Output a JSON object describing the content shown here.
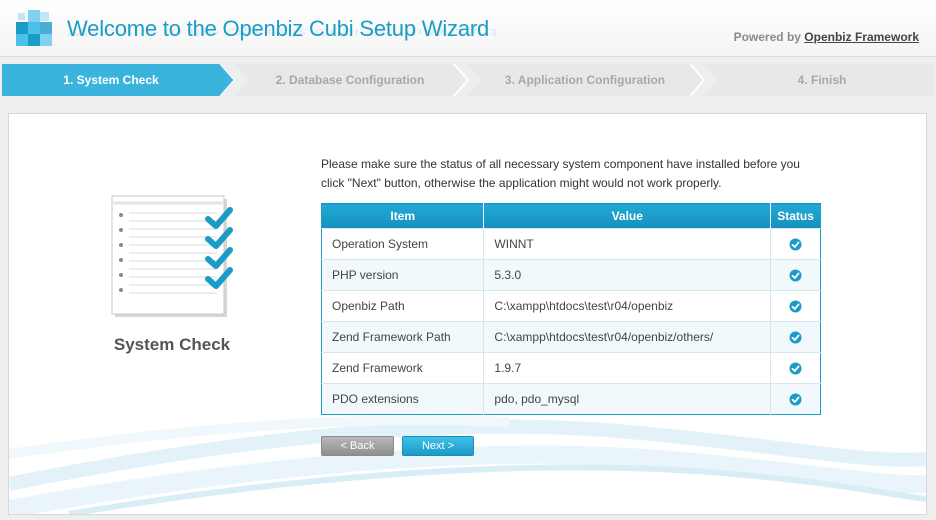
{
  "header": {
    "title": "Welcome to the Openbiz Cubi Setup Wizard",
    "powered_prefix": "Powered by",
    "powered_link": "Openbiz Framework"
  },
  "steps": [
    {
      "label": "1. System Check",
      "active": true
    },
    {
      "label": "2. Database Configuration",
      "active": false
    },
    {
      "label": "3. Application Configuration",
      "active": false
    },
    {
      "label": "4. Finish",
      "active": false
    }
  ],
  "sidebar": {
    "title": "System Check"
  },
  "intro_text": "Please make sure the status of all necessary system component have installed before you click \"Next\" button, otherwise the application might would not work properly.",
  "table": {
    "columns": [
      "Item",
      "Value",
      "Status"
    ],
    "rows": [
      {
        "item": "Operation System",
        "value": "WINNT",
        "status": "ok"
      },
      {
        "item": "PHP version",
        "value": "5.3.0",
        "status": "ok"
      },
      {
        "item": "Openbiz Path",
        "value": "C:\\xampp\\htdocs\\test\\r04/openbiz",
        "status": "ok"
      },
      {
        "item": "Zend Framework Path",
        "value": "C:\\xampp\\htdocs\\test\\r04/openbiz/others/",
        "status": "ok"
      },
      {
        "item": "Zend Framework",
        "value": "1.9.7",
        "status": "ok"
      },
      {
        "item": "PDO extensions",
        "value": "pdo, pdo_mysql",
        "status": "ok"
      }
    ]
  },
  "buttons": {
    "back": "< Back",
    "next": "Next >"
  },
  "colors": {
    "accent": "#1a9cc7",
    "step_active": "#3ab3dd",
    "step_inactive": "#e6e6e6"
  }
}
